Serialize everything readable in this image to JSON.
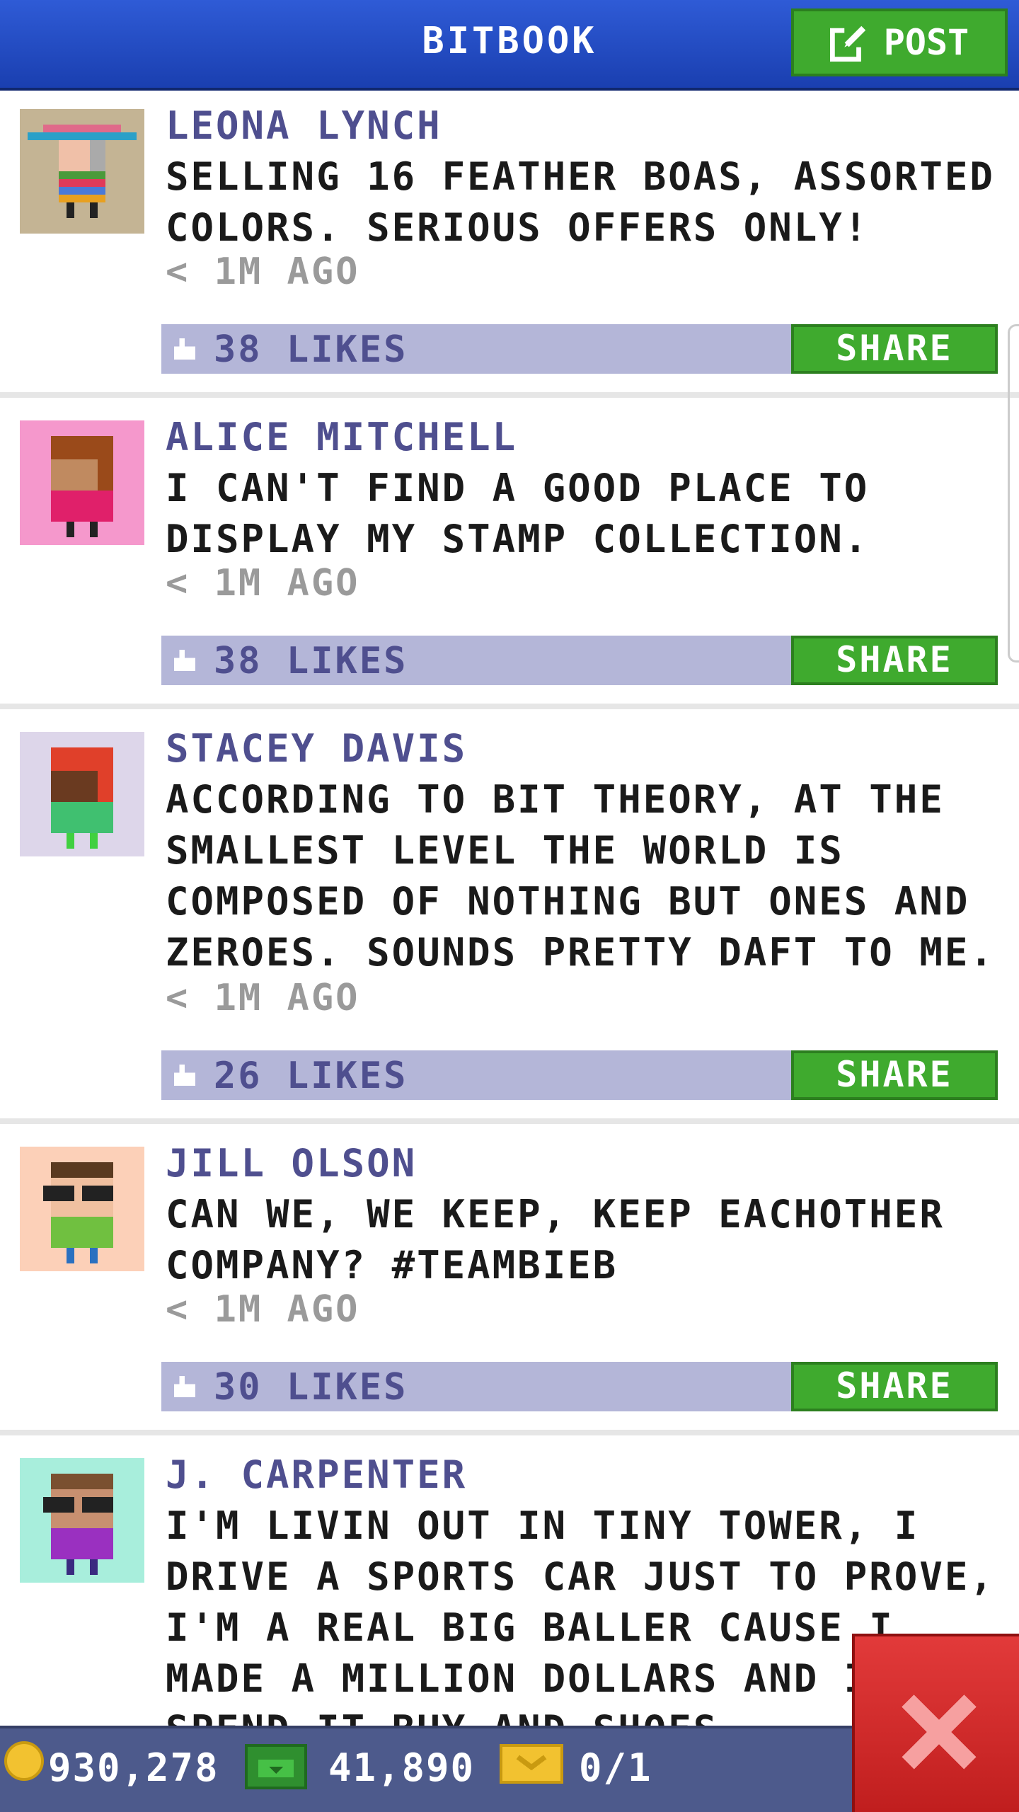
{
  "header": {
    "title": "BITBOOK",
    "post_label": "POST"
  },
  "posts": [
    {
      "author": "LEONA LYNCH",
      "message": "SELLING 16 FEATHER BOAS, ASSORTED COLORS. SERIOUS OFFERS ONLY!",
      "time": "< 1M AGO",
      "likes": "38 LIKES",
      "share": "SHARE",
      "avatar_bg": "#c4b494"
    },
    {
      "author": "ALICE MITCHELL",
      "message": "I CAN'T FIND A GOOD PLACE TO DISPLAY MY STAMP COLLECTION.",
      "time": "< 1M AGO",
      "likes": "38 LIKES",
      "share": "SHARE",
      "avatar_bg": "#f598cc"
    },
    {
      "author": "STACEY DAVIS",
      "message": "ACCORDING TO BIT THEORY, AT THE SMALLEST LEVEL THE WORLD IS COMPOSED OF NOTHING BUT ONES AND ZEROES. SOUNDS PRETTY DAFT TO ME.",
      "time": "< 1M AGO",
      "likes": "26 LIKES",
      "share": "SHARE",
      "avatar_bg": "#ddd6ea"
    },
    {
      "author": "JILL OLSON",
      "message": "CAN WE, WE KEEP, KEEP EACHOTHER COMPANY? #TEAMBIEB",
      "time": "< 1M AGO",
      "likes": "30 LIKES",
      "share": "SHARE",
      "avatar_bg": "#fcd0b8"
    },
    {
      "author": "J. CARPENTER",
      "message": "I'M LIVIN OUT IN TINY TOWER, I DRIVE A SPORTS CAR JUST TO PROVE, I'M A REAL BIG BALLER CAUSE I MADE A MILLION DOLLARS AND I SPEND IT BUY AND SHOES",
      "avatar_bg": "#a8eedc"
    }
  ],
  "footer": {
    "coins": "930,278",
    "bux": "41,890",
    "tickets": "0/1"
  },
  "icons": [
    "edit-icon",
    "thumbs-up-icon",
    "coin-icon",
    "cash-icon",
    "ticket-icon",
    "close-icon"
  ]
}
